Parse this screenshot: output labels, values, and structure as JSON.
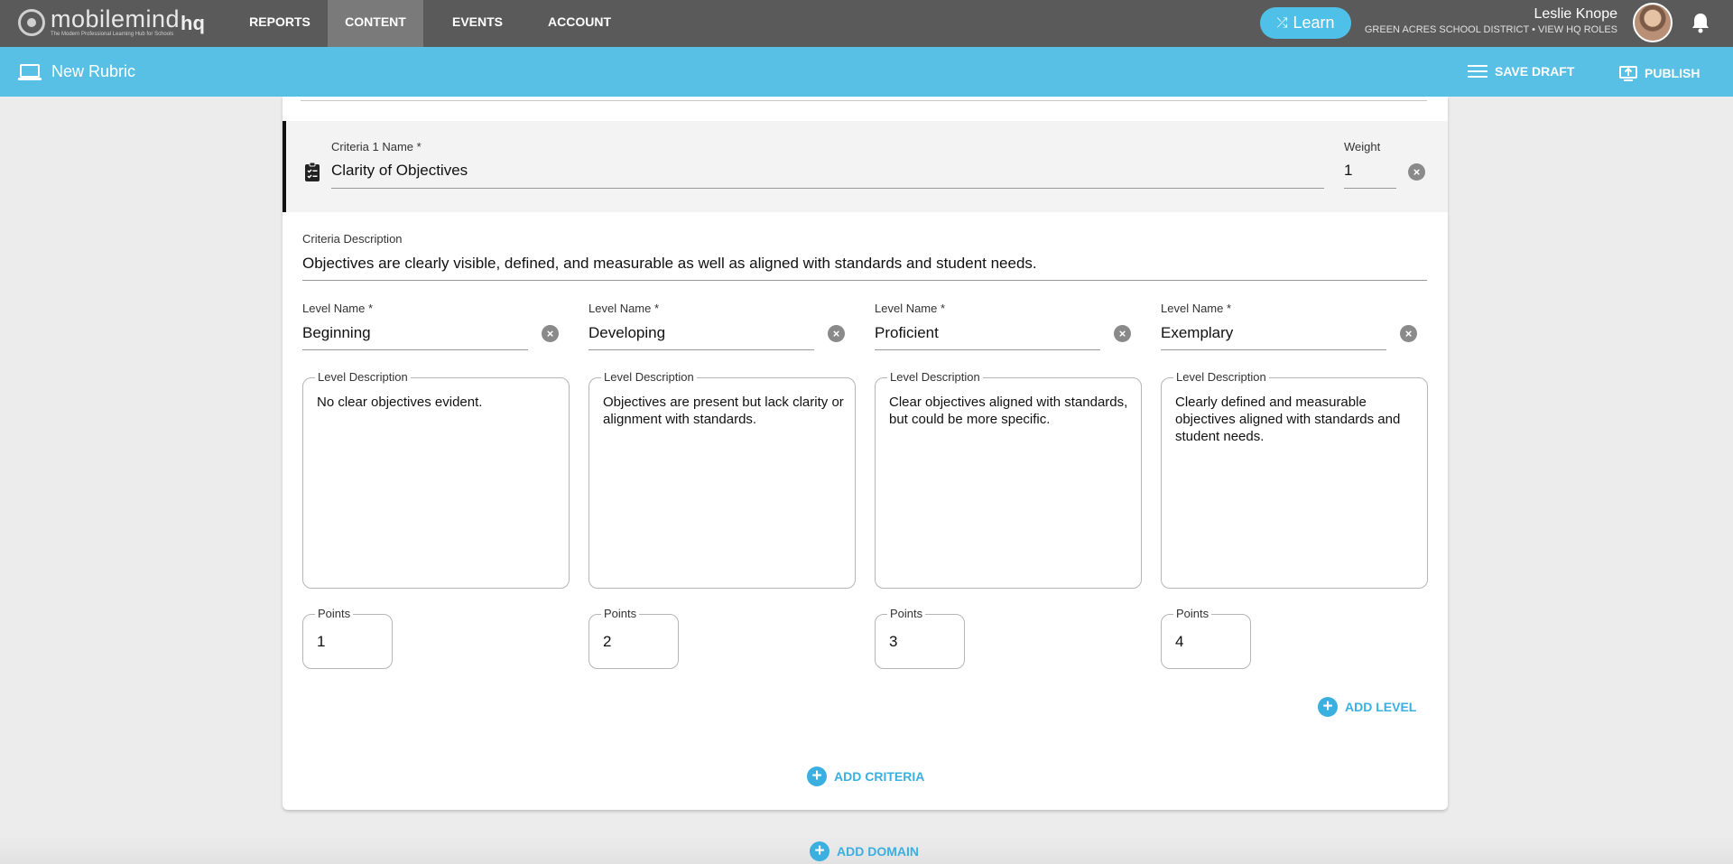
{
  "app": {
    "logo_name": "mobilemind",
    "logo_tagline": "The Modern Professional Learning Hub for Schools",
    "logo_suffix": "hq"
  },
  "nav": {
    "items": [
      "REPORTS",
      "CONTENT",
      "EVENTS",
      "ACCOUNT"
    ],
    "active": "CONTENT",
    "learn_label": "Learn"
  },
  "user": {
    "name": "Leslie Knope",
    "meta": "GREEN ACRES SCHOOL DISTRICT • VIEW HQ ROLES"
  },
  "subheader": {
    "title": "New Rubric",
    "save_draft": "SAVE DRAFT",
    "publish": "PUBLISH"
  },
  "criteria": {
    "name_label": "Criteria 1 Name *",
    "name_value": "Clarity of Objectives",
    "weight_label": "Weight",
    "weight_value": "1",
    "description_label": "Criteria Description",
    "description_value": "Objectives are clearly visible, defined, and measurable as well as aligned with standards and student needs."
  },
  "levels": [
    {
      "name_label": "Level Name *",
      "name": "Beginning",
      "desc_label": "Level Description",
      "description": "No clear objectives evident.",
      "points_label": "Points",
      "points": "1"
    },
    {
      "name_label": "Level Name *",
      "name": "Developing",
      "desc_label": "Level Description",
      "description": "Objectives are present but lack clarity or alignment with standards.",
      "points_label": "Points",
      "points": "2"
    },
    {
      "name_label": "Level Name *",
      "name": "Proficient",
      "desc_label": "Level Description",
      "description": "Clear objectives aligned with standards, but could be more specific.",
      "points_label": "Points",
      "points": "3"
    },
    {
      "name_label": "Level Name *",
      "name": "Exemplary",
      "desc_label": "Level Description",
      "description": "Clearly defined and measurable objectives aligned with standards and student needs.",
      "points_label": "Points",
      "points": "4"
    }
  ],
  "actions": {
    "add_level": "ADD LEVEL",
    "add_criteria": "ADD CRITERIA",
    "add_domain": "ADD DOMAIN"
  },
  "colors": {
    "topnav": "#5a5a5a",
    "accent": "#58c0e4",
    "link": "#3aafe0"
  }
}
